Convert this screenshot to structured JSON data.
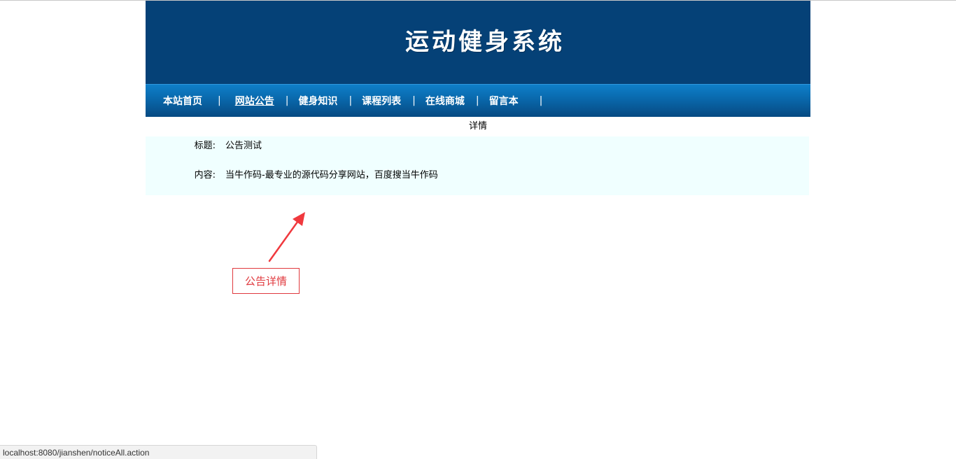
{
  "header": {
    "site_title": "运动健身系统"
  },
  "nav": {
    "separator": "|",
    "items": [
      {
        "label": "本站首页",
        "active": false
      },
      {
        "label": "网站公告",
        "active": true
      },
      {
        "label": "健身知识",
        "active": false
      },
      {
        "label": "课程列表",
        "active": false
      },
      {
        "label": "在线商城",
        "active": false
      },
      {
        "label": "留言本",
        "active": false
      }
    ]
  },
  "detail": {
    "section_title": "详情",
    "title_label": "标题:",
    "title_value": "公告测试",
    "content_label": "内容:",
    "content_value": "当牛作码-最专业的源代码分享网站，百度搜当牛作码"
  },
  "annotation": {
    "label": "公告详情",
    "color": "#e0393e"
  },
  "status_bar": {
    "url": "localhost:8080/jianshen/noticeAll.action"
  },
  "colors": {
    "banner": "#054177",
    "nav_top": "#0f7fc9",
    "nav_bottom": "#064a82",
    "detail_bg": "#f0ffff"
  }
}
